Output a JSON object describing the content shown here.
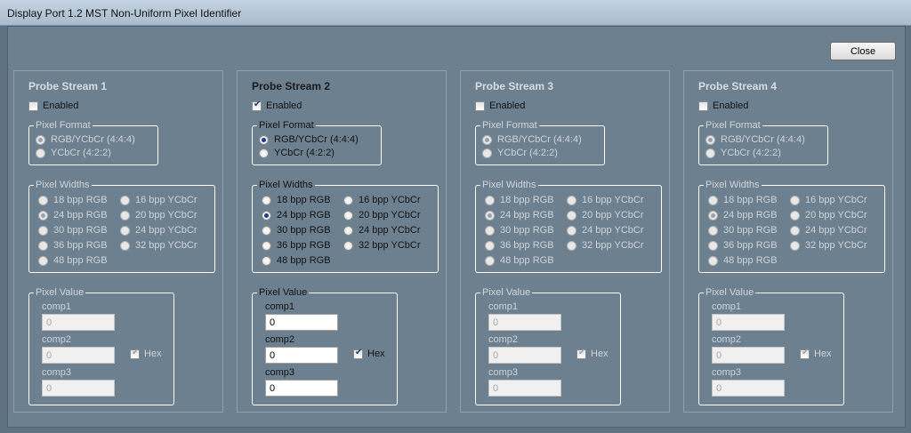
{
  "window": {
    "title": "Display Port 1.2 MST Non-Uniform Pixel Identifier"
  },
  "close_label": "Close",
  "labels": {
    "enabled": "Enabled",
    "pixel_format": "Pixel Format",
    "pixel_widths": "Pixel Widths",
    "pixel_value": "Pixel Value",
    "hex": "Hex"
  },
  "formats": [
    "RGB/YCbCr (4:4:4)",
    "YCbCr (4:2:2)"
  ],
  "widths_rgb": [
    "18 bpp RGB",
    "24 bpp RGB",
    "30 bpp RGB",
    "36 bpp RGB",
    "48 bpp RGB"
  ],
  "widths_ycbcr": [
    "16 bpp YCbCr",
    "20 bpp YCbCr",
    "24 bpp YCbCr",
    "32 bpp YCbCr"
  ],
  "comp_labels": [
    "comp1",
    "comp2",
    "comp3"
  ],
  "streams": [
    {
      "title": "Probe Stream 1",
      "enabled": false,
      "format_selected": 0,
      "width_selected": "24 bpp RGB",
      "comp_values": [
        "0",
        "0",
        "0"
      ],
      "hex": true
    },
    {
      "title": "Probe Stream 2",
      "enabled": true,
      "format_selected": 0,
      "width_selected": "24 bpp RGB",
      "comp_values": [
        "0",
        "0",
        "0"
      ],
      "hex": true
    },
    {
      "title": "Probe Stream 3",
      "enabled": false,
      "format_selected": 0,
      "width_selected": "24 bpp RGB",
      "comp_values": [
        "0",
        "0",
        "0"
      ],
      "hex": true
    },
    {
      "title": "Probe Stream 4",
      "enabled": false,
      "format_selected": 0,
      "width_selected": "24 bpp RGB",
      "comp_values": [
        "0",
        "0",
        "0"
      ],
      "hex": true
    }
  ]
}
